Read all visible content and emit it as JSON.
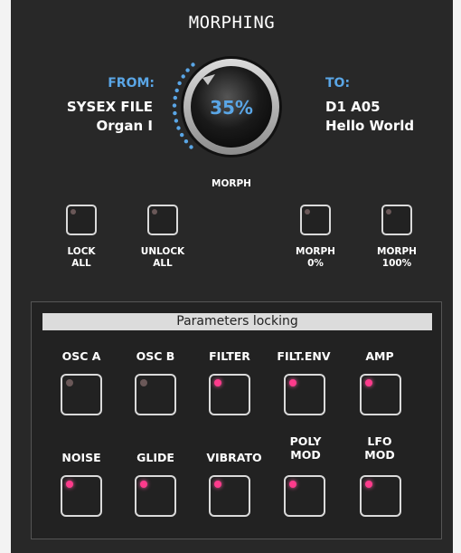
{
  "title": "MORPHING",
  "from": {
    "label": "FROM:",
    "line1": "SYSEX FILE",
    "line2": "Organ I"
  },
  "to": {
    "label": "TO:",
    "line1": "D1 A05",
    "line2": "Hello World"
  },
  "knob": {
    "value": "35%",
    "label": "MORPH",
    "level": 0.35
  },
  "buttons": [
    {
      "l1": "LOCK",
      "l2": "ALL",
      "lit": false
    },
    {
      "l1": "UNLOCK",
      "l2": "ALL",
      "lit": false
    },
    {
      "l1": "MORPH",
      "l2": "0%",
      "lit": false
    },
    {
      "l1": "MORPH",
      "l2": "100%",
      "lit": false
    }
  ],
  "locking": {
    "header": "Parameters locking",
    "row1": [
      {
        "l1": "OSC A",
        "l2": "",
        "lit": false
      },
      {
        "l1": "OSC B",
        "l2": "",
        "lit": false
      },
      {
        "l1": "FILTER",
        "l2": "",
        "lit": true
      },
      {
        "l1": "FILT.ENV",
        "l2": "",
        "lit": true
      },
      {
        "l1": "AMP",
        "l2": "",
        "lit": true
      }
    ],
    "row2": [
      {
        "l1": "NOISE",
        "l2": "",
        "lit": true
      },
      {
        "l1": "GLIDE",
        "l2": "",
        "lit": true
      },
      {
        "l1": "VIBRATO",
        "l2": "",
        "lit": true
      },
      {
        "l1": "POLY",
        "l2": "MOD",
        "lit": true
      },
      {
        "l1": "LFO",
        "l2": "MOD",
        "lit": true
      }
    ]
  },
  "colors": {
    "accent": "#5aa6e6",
    "led_on": "#ff3b8c",
    "led_off": "#6a5858",
    "panel": "#282828"
  }
}
